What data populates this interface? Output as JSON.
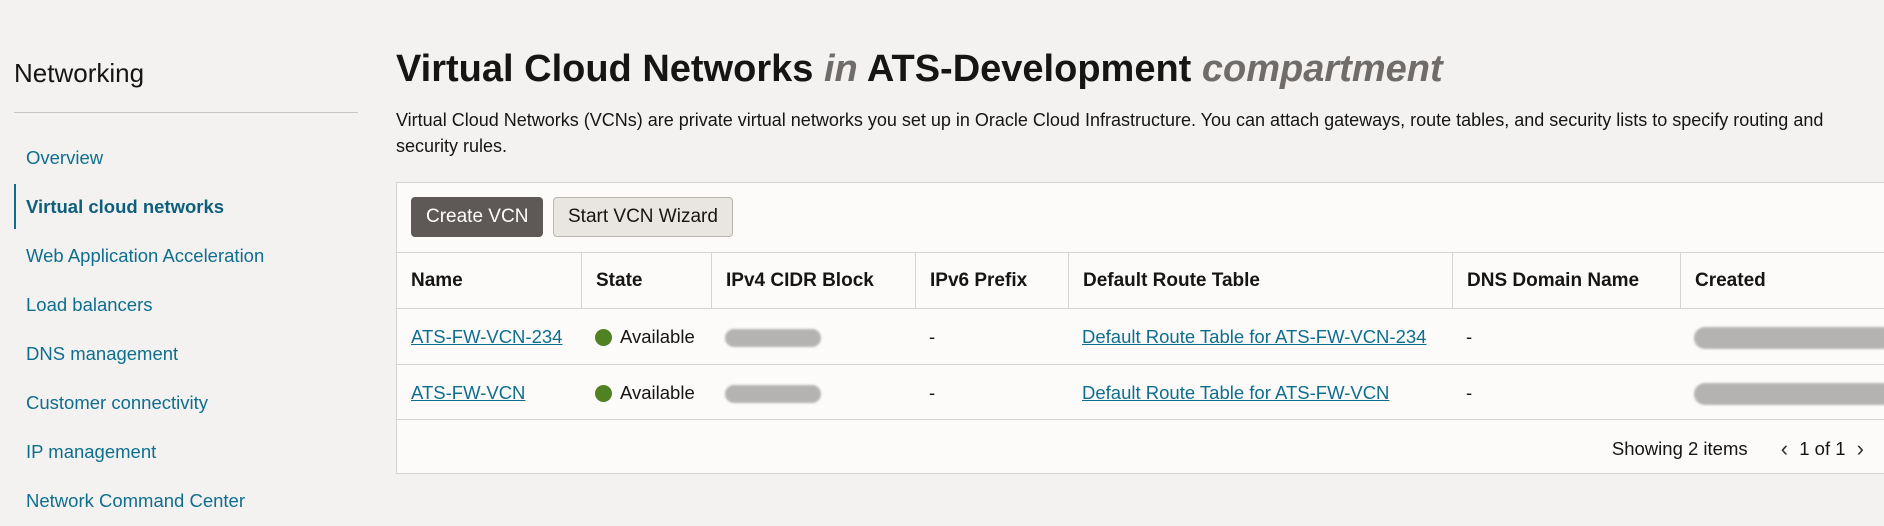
{
  "sidebar": {
    "title": "Networking",
    "items": [
      {
        "label": "Overview"
      },
      {
        "label": "Virtual cloud networks"
      },
      {
        "label": "Web Application Acceleration"
      },
      {
        "label": "Load balancers"
      },
      {
        "label": "DNS management"
      },
      {
        "label": "Customer connectivity"
      },
      {
        "label": "IP management"
      },
      {
        "label": "Network Command Center"
      }
    ],
    "active_item": "Virtual cloud networks"
  },
  "header": {
    "title_main": "Virtual Cloud Networks",
    "title_in": "in",
    "compartment": "ATS-Development",
    "title_suffix": "compartment",
    "description": "Virtual Cloud Networks (VCNs) are private virtual networks you set up in Oracle Cloud Infrastructure. You can attach gateways, route tables, and security lists to specify routing and security rules."
  },
  "toolbar": {
    "create_label": "Create VCN",
    "wizard_label": "Start VCN Wizard"
  },
  "table": {
    "columns": [
      "Name",
      "State",
      "IPv4 CIDR Block",
      "IPv6 Prefix",
      "Default Route Table",
      "DNS Domain Name",
      "Created"
    ],
    "rows": [
      {
        "name": "ATS-FW-VCN-234",
        "state": "Available",
        "ipv6": "-",
        "route_table": "Default Route Table for ATS-FW-VCN-234",
        "dns": "-"
      },
      {
        "name": "ATS-FW-VCN",
        "state": "Available",
        "ipv6": "-",
        "route_table": "Default Route Table for ATS-FW-VCN",
        "dns": "-"
      }
    ]
  },
  "pagination": {
    "showing": "Showing 2 items",
    "page": "1 of 1"
  },
  "colors": {
    "link": "#0f6e8e",
    "available": "#508223",
    "primary_button": "#5e5956"
  }
}
